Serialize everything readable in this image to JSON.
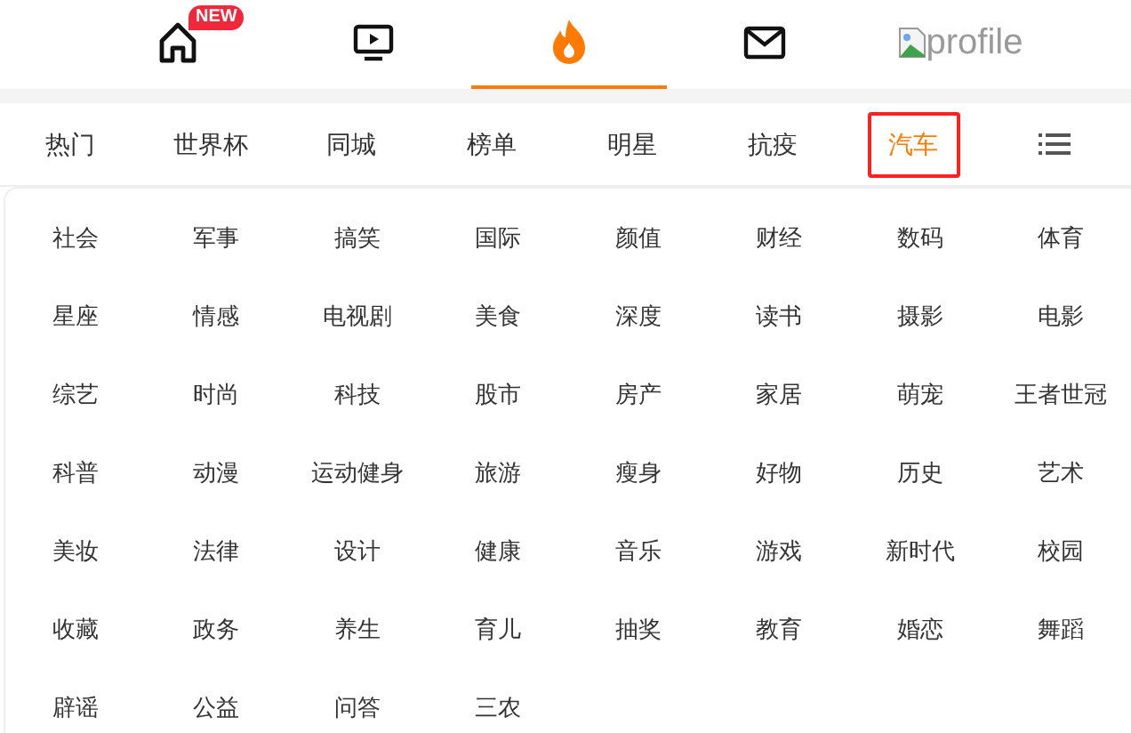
{
  "nav": [
    {
      "kind": "home",
      "selected": false,
      "badge": "NEW"
    },
    {
      "kind": "video",
      "selected": false
    },
    {
      "kind": "hot",
      "selected": true
    },
    {
      "kind": "mail",
      "selected": false
    },
    {
      "kind": "avatar",
      "selected": false,
      "alt": "profile"
    }
  ],
  "channels": [
    {
      "label": "热门",
      "selected": false
    },
    {
      "label": "世界杯",
      "selected": false
    },
    {
      "label": "同城",
      "selected": false
    },
    {
      "label": "榜单",
      "selected": false
    },
    {
      "label": "明星",
      "selected": false
    },
    {
      "label": "抗疫",
      "selected": false
    },
    {
      "label": "汽车",
      "selected": true
    }
  ],
  "categories": [
    "社会",
    "军事",
    "搞笑",
    "国际",
    "颜值",
    "财经",
    "数码",
    "体育",
    "星座",
    "情感",
    "电视剧",
    "美食",
    "深度",
    "读书",
    "摄影",
    "电影",
    "综艺",
    "时尚",
    "科技",
    "股市",
    "房产",
    "家居",
    "萌宠",
    "王者世冠",
    "科普",
    "动漫",
    "运动健身",
    "旅游",
    "瘦身",
    "好物",
    "历史",
    "艺术",
    "美妆",
    "法律",
    "设计",
    "健康",
    "音乐",
    "游戏",
    "新时代",
    "校园",
    "收藏",
    "政务",
    "养生",
    "育儿",
    "抽奖",
    "教育",
    "婚恋",
    "舞蹈",
    "辟谣",
    "公益",
    "问答",
    "三农"
  ]
}
